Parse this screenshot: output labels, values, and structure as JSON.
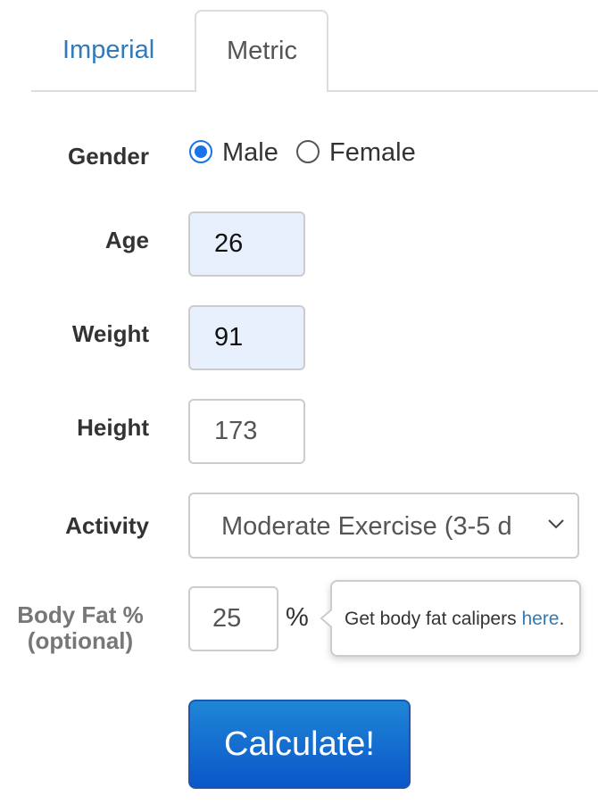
{
  "tabs": {
    "imperial": "Imperial",
    "metric": "Metric"
  },
  "labels": {
    "gender": "Gender",
    "age": "Age",
    "weight": "Weight",
    "height": "Height",
    "activity": "Activity",
    "body_fat_line1": "Body Fat %",
    "body_fat_line2": "(optional)"
  },
  "gender": {
    "male": "Male",
    "female": "Female",
    "selected": "Male"
  },
  "fields": {
    "age": "26",
    "weight": "91",
    "height": "173",
    "body_fat": "25",
    "percent_unit": "%"
  },
  "activity": {
    "selected": "Moderate Exercise (3-5 d"
  },
  "tooltip": {
    "text": "Get body fat calipers ",
    "link": "here",
    "end": "."
  },
  "calculate_button": "Calculate!",
  "colors": {
    "accent": "#1a73e8",
    "link": "#337ab7",
    "button": "#0a57c9",
    "autofill": "#e8f0fe"
  }
}
